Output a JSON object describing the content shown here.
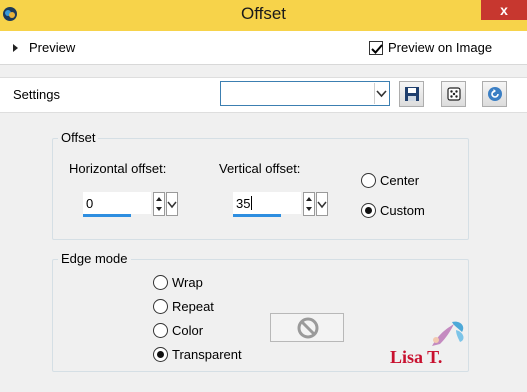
{
  "window": {
    "title": "Offset",
    "close_label": "x",
    "app_icon": "psp-app-icon",
    "close_icon": "close-icon"
  },
  "preview": {
    "label": "Preview",
    "preview_on_image_label": "Preview on Image",
    "preview_on_image_checked": true
  },
  "settings": {
    "label": "Settings",
    "preset_value": "",
    "tools": [
      "save-icon",
      "randomize-dice-icon",
      "reset-icon"
    ]
  },
  "offset_group": {
    "title": "Offset",
    "horizontal_label": "Horizontal offset:",
    "horizontal_value": "0",
    "vertical_label": "Vertical offset:",
    "vertical_value": "35",
    "center_label": "Center",
    "custom_label": "Custom",
    "selected": "Custom"
  },
  "edge_group": {
    "title": "Edge mode",
    "wrap_label": "Wrap",
    "repeat_label": "Repeat",
    "color_label": "Color",
    "transparent_label": "Transparent",
    "selected": "Transparent",
    "color_swatch_icon": "no-color-icon"
  },
  "watermark": {
    "text": "Lisa T.",
    "color": "#c8102e"
  },
  "colors": {
    "titlebar": "#f7d34a",
    "accent": "#2e8ee0",
    "close": "#c7372f"
  }
}
